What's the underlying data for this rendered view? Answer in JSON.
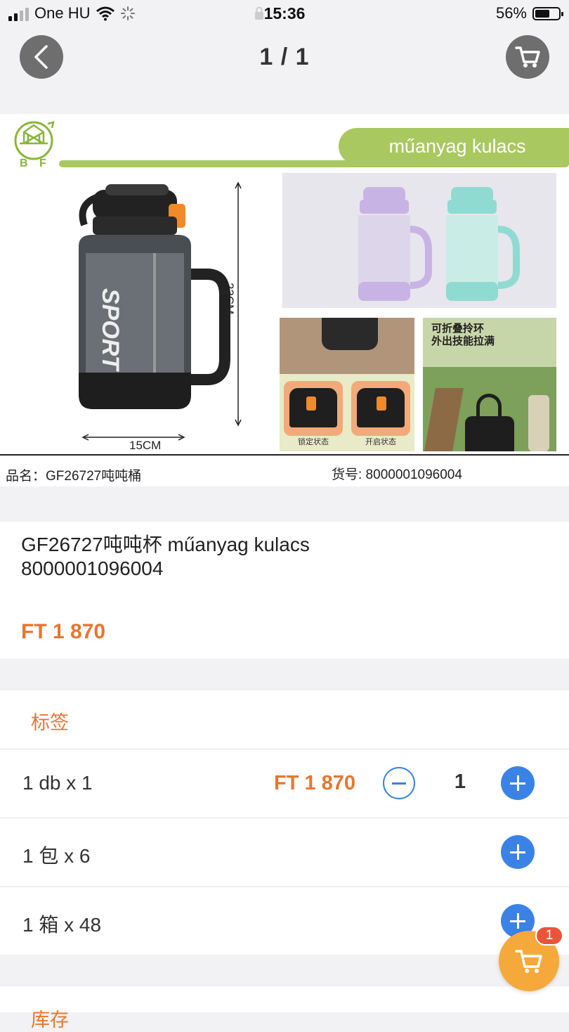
{
  "status_bar": {
    "carrier": "One HU",
    "time": "15:36",
    "battery": "56%",
    "battery_level": 0.56,
    "signal_bars": 2
  },
  "nav": {
    "page_counter": "1 / 1",
    "back_icon": "chevron-left-icon",
    "cart_icon": "cart-icon"
  },
  "product_image": {
    "brand_text": "B F",
    "banner_text": "műanyag kulacs",
    "height_label": "23CM",
    "width_label": "15CM",
    "bottle_text": "SPORT",
    "lifestyle_caption_line1": "可折叠拎环",
    "lifestyle_caption_line2": "外出技能拉满",
    "lock_state_label": "锁定状态",
    "open_state_label": "开启状态",
    "caption_name": "品名：GF26727吨吨桶",
    "caption_code": "货号: 8000001096004"
  },
  "product": {
    "title": "GF26727吨吨杯 műanyag kulacs 8000001096004",
    "price": "FT 1 870"
  },
  "options": {
    "section_label": "标签",
    "rows": [
      {
        "label": "1 db x 1",
        "price": "FT 1 870",
        "qty": "1"
      },
      {
        "label": "1 包 x 6"
      },
      {
        "label": "1 箱 x 48"
      }
    ]
  },
  "next_section": {
    "label": "库存"
  },
  "floating_cart": {
    "badge": "1"
  },
  "colors": {
    "accent_orange": "#e8762f",
    "button_blue": "#3b82e6",
    "cart_orange": "#f5a93a",
    "badge_red": "#e9553a",
    "banner_green": "#a9c860"
  }
}
